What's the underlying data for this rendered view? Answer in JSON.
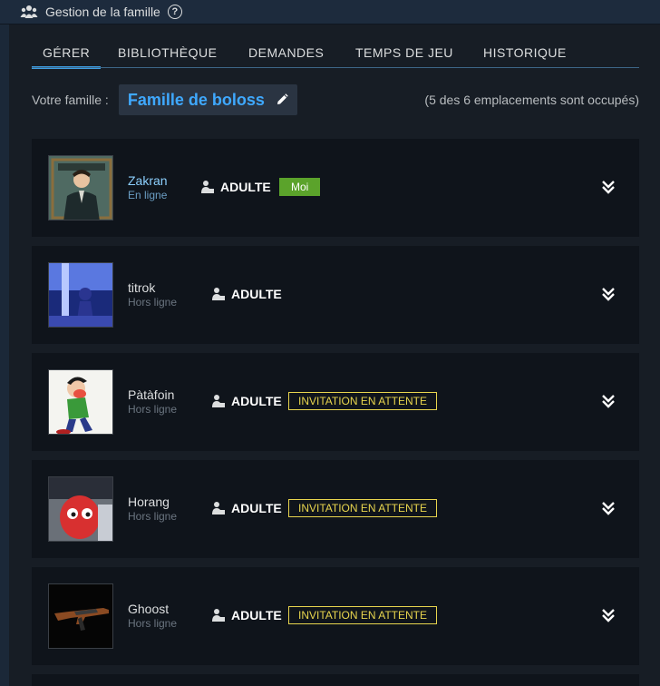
{
  "header": {
    "title": "Gestion de la famille",
    "help_glyph": "?"
  },
  "tabs": [
    {
      "label": "GÉRER",
      "active": true
    },
    {
      "label": "BIBLIOTHÈQUE",
      "active": false
    },
    {
      "label": "DEMANDES",
      "active": false
    },
    {
      "label": "TEMPS DE JEU",
      "active": false
    },
    {
      "label": "HISTORIQUE",
      "active": false
    }
  ],
  "family": {
    "label": "Votre famille :",
    "name": "Famille de boloss",
    "slots": "(5 des 6 emplacements sont occupés)"
  },
  "members": [
    {
      "name": "Zakran",
      "status": "En ligne",
      "online": true,
      "role": "ADULTE",
      "badge": "Moi",
      "badge_type": "me",
      "avatar": "character-portrait"
    },
    {
      "name": "titrok",
      "status": "Hors ligne",
      "online": false,
      "role": "ADULTE",
      "badge": "",
      "badge_type": "none",
      "avatar": "blue-figure"
    },
    {
      "name": "Pàtàfoin",
      "status": "Hors ligne",
      "online": false,
      "role": "ADULTE",
      "badge": "INVITATION EN ATTENTE",
      "badge_type": "invite",
      "avatar": "cartoon-character"
    },
    {
      "name": "Horang",
      "status": "Hors ligne",
      "online": false,
      "role": "ADULTE",
      "badge": "INVITATION EN ATTENTE",
      "badge_type": "invite",
      "avatar": "red-creature"
    },
    {
      "name": "Ghoost",
      "status": "Hors ligne",
      "online": false,
      "role": "ADULTE",
      "badge": "INVITATION EN ATTENTE",
      "badge_type": "invite",
      "avatar": "rifle"
    }
  ],
  "colors": {
    "background": "#1b2838",
    "accent": "#3d9ee2",
    "family_name": "#3fa9ff",
    "badge_me": "#5ba32b",
    "badge_invite": "#e8d54e"
  }
}
